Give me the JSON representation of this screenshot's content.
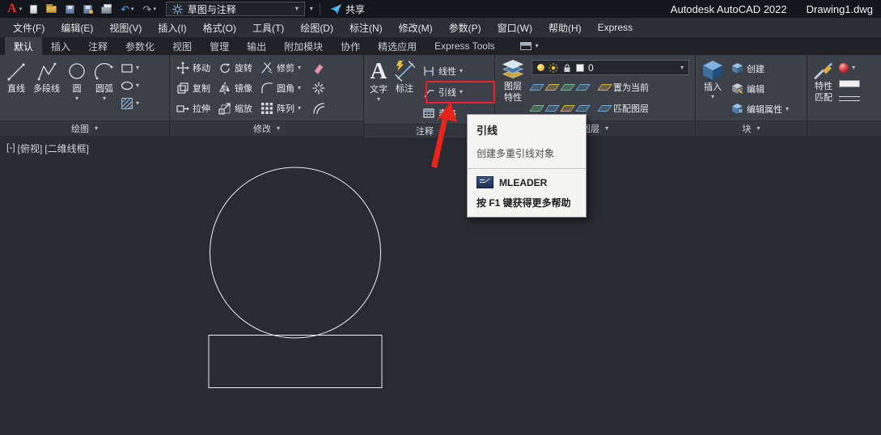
{
  "colors": {
    "highlight_red": "#e8241c",
    "share_blue": "#38a6ea",
    "logo_red": "#e02b36",
    "ribbon_bg": "#3b4049",
    "canvas_bg": "#282b31"
  },
  "titlebar": {
    "workspace": "草图与注释",
    "share_label": "共享",
    "app_title": "Autodesk AutoCAD 2022",
    "doc_title": "Drawing1.dwg"
  },
  "menubar": {
    "items": [
      "文件(F)",
      "编辑(E)",
      "视图(V)",
      "插入(I)",
      "格式(O)",
      "工具(T)",
      "绘图(D)",
      "标注(N)",
      "修改(M)",
      "参数(P)",
      "窗口(W)",
      "帮助(H)",
      "Express"
    ]
  },
  "tabs": {
    "items": [
      "默认",
      "插入",
      "注释",
      "参数化",
      "视图",
      "管理",
      "输出",
      "附加模块",
      "协作",
      "精选应用",
      "Express Tools"
    ],
    "active_index": 0
  },
  "ribbon": {
    "draw": {
      "label": "绘图",
      "line": "直线",
      "polyline": "多段线",
      "circle": "圆",
      "arc": "圆弧"
    },
    "modify": {
      "label": "修改",
      "move": "移动",
      "rotate": "旋转",
      "trim": "修剪",
      "copy": "复制",
      "mirror": "镜像",
      "fillet": "圆角",
      "stretch": "拉伸",
      "scale": "缩放",
      "array": "阵列"
    },
    "annotate": {
      "label": "注释",
      "text": "文字",
      "dimension": "标注",
      "linear": "线性",
      "leader": "引线",
      "table": "表格"
    },
    "layers": {
      "label": "图层",
      "layer_props_1": "图层",
      "layer_props_2": "特性",
      "current_layer": "0",
      "make_current": "置为当前",
      "match_layer": "匹配图层"
    },
    "block": {
      "label": "块",
      "insert": "插入",
      "create": "创建",
      "edit": "编辑",
      "edit_attrs": "编辑属性"
    },
    "properties": {
      "match_1": "特性",
      "match_2": "匹配"
    }
  },
  "tooltip": {
    "title": "引线",
    "description": "创建多重引线对象",
    "command": "MLEADER",
    "help": "按 F1 键获得更多帮助"
  },
  "viewport": {
    "controls": [
      "[-]",
      "[俯视]",
      "[二维线框]"
    ]
  },
  "icons": {
    "caret_down": "▾",
    "undo": "↶",
    "redo": "↷"
  }
}
